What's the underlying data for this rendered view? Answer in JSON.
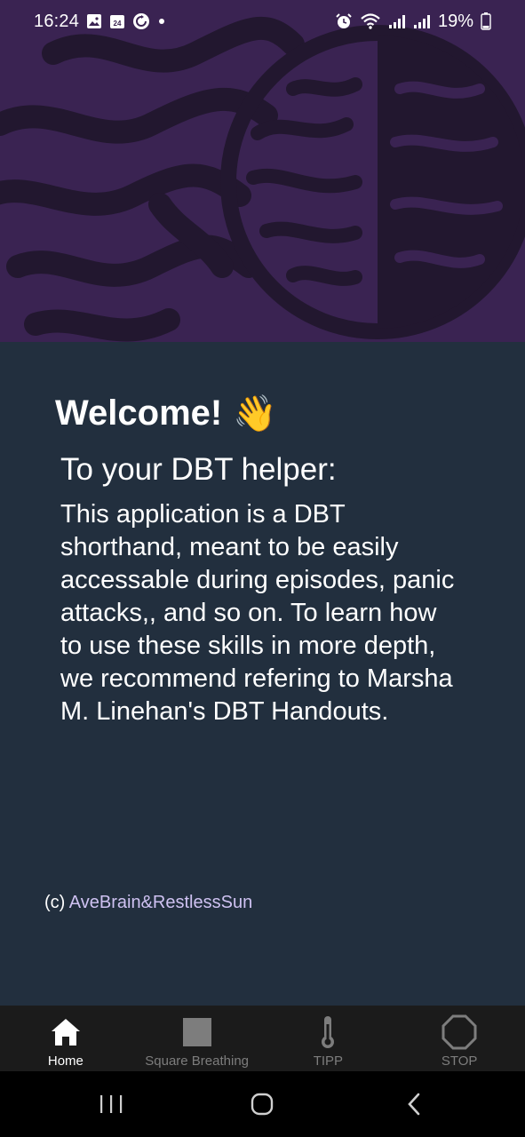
{
  "status_bar": {
    "time": "16:24",
    "battery": "19%",
    "icons_left": [
      "gallery-icon",
      "calendar-icon",
      "sync-icon",
      "dot-icon"
    ],
    "icons_right": [
      "alarm-icon",
      "wifi-icon",
      "signal-icon",
      "signal-icon",
      "battery-icon"
    ],
    "calendar_day": "24"
  },
  "main": {
    "welcome": "Welcome!",
    "wave_emoji": "👋",
    "subtitle": "To your DBT helper:",
    "body": "This application is a DBT shorthand, meant to be easily accessable during episodes, panic attacks,, and so on. To learn how to use these skills in more depth, we recommend refering to Marsha M. Linehan's DBT Handouts.",
    "credit_prefix": "(c) ",
    "credit_link": "AveBrain&RestlessSun"
  },
  "bottom_nav": {
    "items": [
      {
        "label": "Home",
        "icon": "home-icon",
        "active": true
      },
      {
        "label": "Square Breathing",
        "icon": "square-icon",
        "active": false
      },
      {
        "label": "TIPP",
        "icon": "thermometer-icon",
        "active": false
      },
      {
        "label": "STOP",
        "icon": "octagon-icon",
        "active": false
      }
    ]
  },
  "colors": {
    "hero_bg": "#3a2352",
    "hero_pattern": "#22172f",
    "main_bg": "#222f3e",
    "nav_bg": "#1b1b1b",
    "link": "#cfc2f2"
  }
}
